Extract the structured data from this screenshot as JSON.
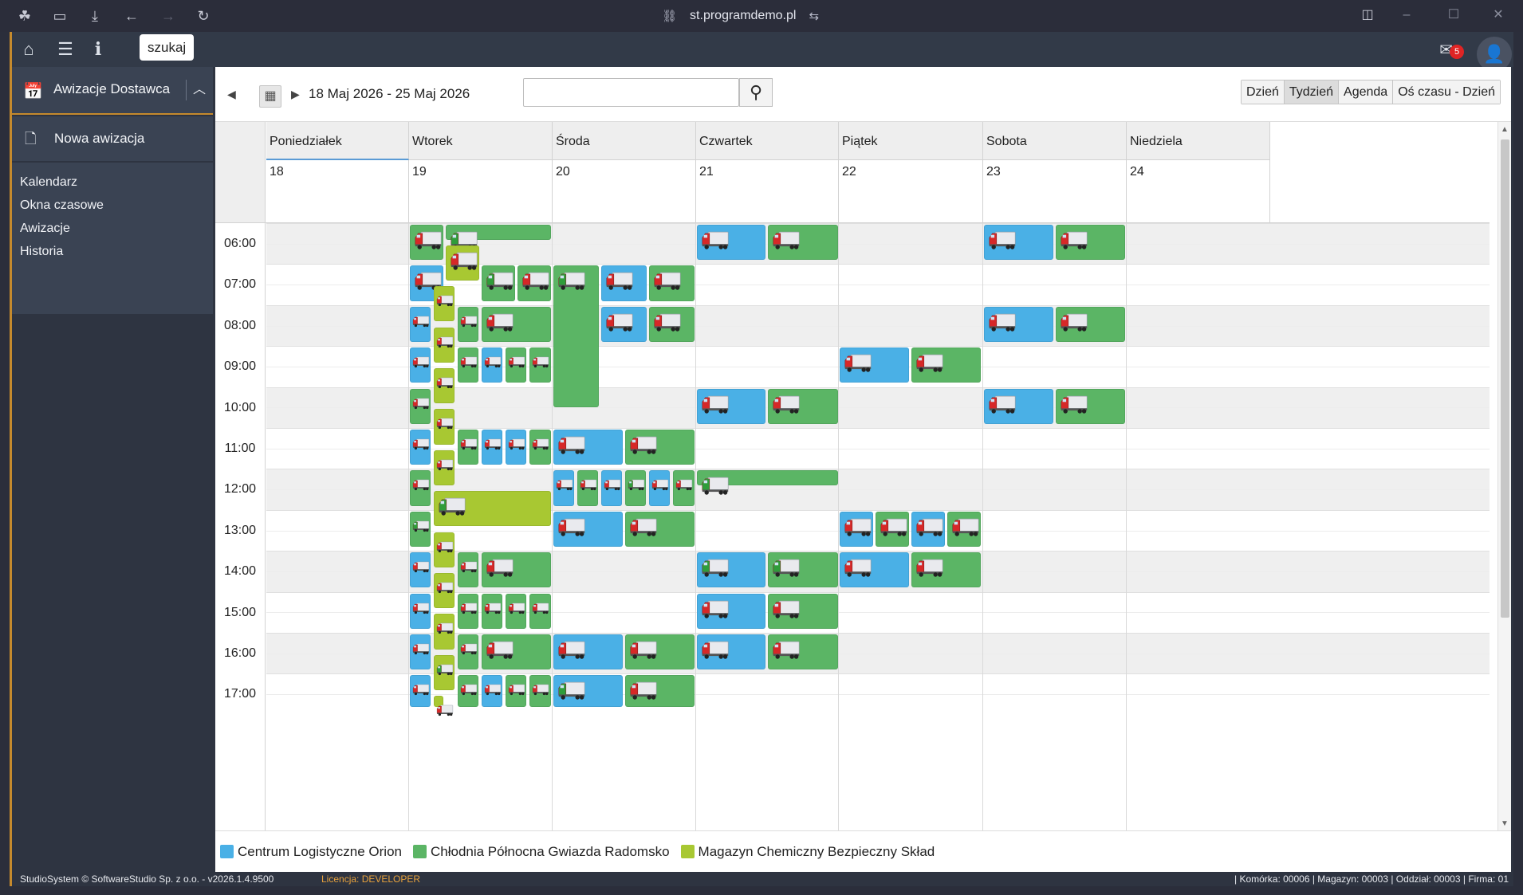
{
  "browser": {
    "url": "st.programdemo.pl"
  },
  "toolbar": {
    "search_label": "szukaj",
    "mail_count": "5"
  },
  "sidebar": {
    "module": "Awizacje Dostawca",
    "new_item": "Nowa awizacja",
    "items": [
      "Kalendarz",
      "Okna czasowe",
      "Awizacje",
      "Historia"
    ]
  },
  "calendar": {
    "range": "18 Maj 2026 - 25 Maj 2026",
    "views": [
      "Dzień",
      "Tydzień",
      "Agenda",
      "Oś czasu - Dzień"
    ],
    "days": [
      {
        "name": "Poniedziałek",
        "num": "18"
      },
      {
        "name": "Wtorek",
        "num": "19"
      },
      {
        "name": "Środa",
        "num": "20"
      },
      {
        "name": "Czwartek",
        "num": "21"
      },
      {
        "name": "Piątek",
        "num": "22"
      },
      {
        "name": "Sobota",
        "num": "23"
      },
      {
        "name": "Niedziela",
        "num": "24"
      }
    ],
    "hours": [
      "06:00",
      "07:00",
      "08:00",
      "09:00",
      "10:00",
      "11:00",
      "12:00",
      "13:00",
      "14:00",
      "15:00",
      "16:00",
      "17:00"
    ]
  },
  "legend": [
    {
      "label": "Centrum Logistyczne Orion",
      "color": "#4ab0e6"
    },
    {
      "label": "Chłodnia Północna Gwiazda Radomsko",
      "color": "#5bb565"
    },
    {
      "label": "Magazyn Chemiczny Bezpieczny Skład",
      "color": "#a8c832"
    }
  ],
  "footer": {
    "copyright": "StudioSystem © SoftwareStudio Sp. z o.o. - v2026.1.4.9500",
    "license": "Licencja: DEVELOPER",
    "session": "| Komórka: 00006 | Magazyn: 00003 | Oddział: 00003 | Firma: 01"
  }
}
